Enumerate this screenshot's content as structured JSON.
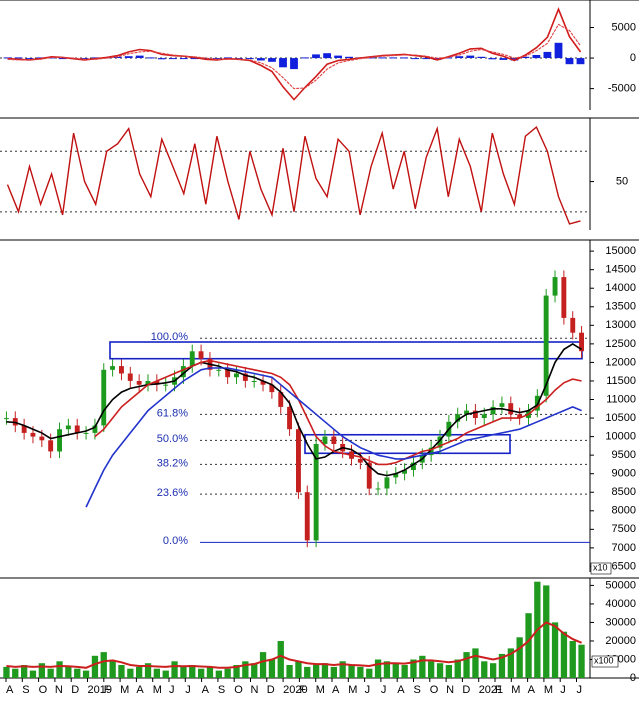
{
  "colors": {
    "price_up": "#1d9a1d",
    "price_down": "#c42020",
    "volume_bar": "#1f9a1f",
    "ma_short": "#000000",
    "ma_mid": "#cc1f1f",
    "ma_long": "#2233cc",
    "macd_hist": "#1020dd",
    "rsi_line": "#c01010",
    "fib_text": "#1d2fb0",
    "box_stroke": "#1622c6",
    "grid_dotted": "#333333",
    "axis_text": "#000000"
  },
  "chart_data": [
    {
      "type": "line",
      "panel": "macd",
      "y_ticks": [
        5000,
        0,
        -5000
      ],
      "y_tick_labels": [
        "5000",
        "0",
        "-5000"
      ],
      "ylim": [
        -8500,
        9500
      ],
      "series": [
        {
          "key": "macd",
          "color": "#d01c1c",
          "values": [
            -0.1,
            -0.2,
            -0.3,
            -0.1,
            0.2,
            0.1,
            -0.1,
            -0.3,
            -0.1,
            0.1,
            0.4,
            1.0,
            1.4,
            1.2,
            0.6,
            0.4,
            0.3,
            0.1,
            -0.2,
            -0.3,
            -0.1,
            -0.2,
            -0.4,
            -1.2,
            -2.2,
            -4.7,
            -6.8,
            -4.8,
            -3.0,
            -1.0,
            -0.4,
            -0.2,
            0.0,
            0.2,
            0.4,
            0.5,
            0.6,
            0.4,
            0.2,
            -0.3,
            0.2,
            0.8,
            1.5,
            1.6,
            0.8,
            0.3,
            -0.4,
            0.5,
            1.7,
            3.4,
            8.0,
            3.5,
            1.0
          ]
        },
        {
          "key": "signal",
          "color": "#e04040",
          "values": [
            -0.2,
            -0.3,
            -0.3,
            -0.2,
            0.1,
            0.1,
            0.0,
            -0.2,
            -0.2,
            0.0,
            0.2,
            0.7,
            1.0,
            1.1,
            0.8,
            0.5,
            0.3,
            0.2,
            0.0,
            -0.2,
            -0.2,
            -0.2,
            -0.3,
            -0.8,
            -1.6,
            -3.2,
            -5.0,
            -4.9,
            -3.6,
            -1.8,
            -0.8,
            -0.4,
            -0.1,
            0.1,
            0.3,
            0.4,
            0.5,
            0.5,
            0.3,
            0.0,
            0.1,
            0.5,
            1.1,
            1.4,
            1.0,
            0.6,
            0.0,
            0.3,
            1.2,
            2.4,
            5.5,
            4.5,
            2.0
          ]
        }
      ],
      "histogram": [
        0.1,
        0.1,
        0.0,
        0.1,
        0.1,
        0.0,
        -0.1,
        -0.1,
        0.1,
        0.1,
        0.2,
        0.3,
        0.4,
        0.1,
        -0.2,
        -0.1,
        0.0,
        -0.1,
        -0.2,
        -0.1,
        0.1,
        0.0,
        -0.1,
        -0.4,
        -0.6,
        -1.5,
        -1.8,
        0.1,
        0.6,
        0.8,
        0.4,
        0.2,
        0.1,
        0.1,
        0.1,
        0.1,
        0.1,
        -0.1,
        -0.1,
        -0.3,
        0.1,
        0.3,
        0.4,
        0.2,
        -0.2,
        -0.3,
        -0.4,
        0.2,
        0.5,
        1.0,
        2.5,
        -1.0,
        -1.0
      ]
    },
    {
      "type": "line",
      "panel": "rsi",
      "y_ticks": [
        50
      ],
      "y_tick_labels": [
        "50"
      ],
      "guides": [
        70,
        30
      ],
      "ylim": [
        18,
        92
      ],
      "series": [
        {
          "key": "rsi",
          "color": "#c01010",
          "values": [
            48,
            30,
            60,
            35,
            55,
            28,
            82,
            50,
            35,
            70,
            75,
            85,
            55,
            40,
            78,
            60,
            42,
            75,
            35,
            80,
            50,
            25,
            70,
            45,
            28,
            72,
            30,
            80,
            52,
            40,
            78,
            70,
            28,
            60,
            82,
            45,
            70,
            32,
            66,
            85,
            40,
            78,
            60,
            30,
            82,
            55,
            35,
            80,
            86,
            70,
            40,
            22,
            24
          ]
        }
      ]
    },
    {
      "type": "candlestick",
      "panel": "price",
      "x": [
        "A",
        "S",
        "O",
        "N",
        "D",
        "2019",
        "F",
        "M",
        "A",
        "M",
        "J",
        "J",
        "A",
        "S",
        "O",
        "N",
        "D",
        "2020",
        "F",
        "M",
        "A",
        "M",
        "J",
        "J",
        "A",
        "S",
        "O",
        "N",
        "D",
        "2021",
        "F",
        "M",
        "A",
        "M",
        "J",
        "J"
      ],
      "y_ticks": [
        6500,
        7000,
        7500,
        8000,
        8500,
        9000,
        9500,
        10000,
        10500,
        11000,
        11500,
        12000,
        12500,
        13000,
        13500,
        14000,
        14500,
        15000
      ],
      "y_tick_labels": [
        "6500",
        "7000",
        "7500",
        "8000",
        "8500",
        "9000",
        "9500",
        "10000",
        "10500",
        "11000",
        "11500",
        "12000",
        "12500",
        "13000",
        "13500",
        "14000",
        "14500",
        "15000"
      ],
      "ylim": [
        6350,
        15300
      ],
      "axis_unit_label": "x10",
      "close": [
        10500,
        10300,
        10100,
        10000,
        9900,
        9600,
        10200,
        10300,
        10100,
        10100,
        10300,
        11800,
        11900,
        11700,
        11500,
        11400,
        11500,
        11400,
        11400,
        11600,
        11900,
        12300,
        12100,
        11800,
        11800,
        11600,
        11700,
        11500,
        11500,
        11400,
        11200,
        10800,
        10200,
        8500,
        7200,
        9800,
        10000,
        9800,
        9600,
        9400,
        9300,
        8600,
        8600,
        8900,
        9000,
        9100,
        9300,
        9500,
        9700,
        10000,
        10400,
        10600,
        10700,
        10500,
        10600,
        10800,
        10900,
        10600,
        10500,
        10700,
        11100,
        13800,
        14300,
        13200,
        12800,
        12300
      ],
      "ma_series": [
        {
          "key": "ma_short",
          "color": "#000000",
          "values": [
            10400,
            10380,
            10300,
            10200,
            10100,
            9950,
            10000,
            10050,
            10100,
            10150,
            10250,
            10700,
            11000,
            11200,
            11300,
            11350,
            11400,
            11420,
            11450,
            11500,
            11700,
            11900,
            12000,
            11950,
            11900,
            11800,
            11750,
            11650,
            11600,
            11500,
            11400,
            11200,
            10900,
            10300,
            9800,
            9400,
            9450,
            9600,
            9700,
            9650,
            9500,
            9200,
            9000,
            8950,
            9000,
            9100,
            9250,
            9400,
            9650,
            9900,
            10200,
            10450,
            10600,
            10650,
            10700,
            10750,
            10750,
            10700,
            10650,
            10700,
            10850,
            11400,
            12000,
            12350,
            12500,
            12350
          ]
        },
        {
          "key": "ma_mid",
          "color": "#cc1f1f",
          "values": [
            null,
            null,
            null,
            null,
            null,
            null,
            null,
            null,
            null,
            null,
            10000,
            10200,
            10500,
            10800,
            11000,
            11200,
            11400,
            11500,
            11600,
            11700,
            11800,
            11900,
            12000,
            12050,
            12000,
            11950,
            11900,
            11850,
            11800,
            11750,
            11700,
            11600,
            11400,
            11000,
            10500,
            10000,
            9750,
            9600,
            9550,
            9500,
            9450,
            9350,
            9250,
            9250,
            9300,
            9400,
            9500,
            9600,
            9650,
            9750,
            9850,
            9950,
            10100,
            10200,
            10300,
            10400,
            10500,
            10500,
            10500,
            10600,
            10800,
            11000,
            11250,
            11450,
            11550,
            11500
          ]
        },
        {
          "key": "ma_long",
          "color": "#2233cc",
          "values": [
            null,
            null,
            null,
            null,
            null,
            null,
            null,
            null,
            null,
            8100,
            8600,
            9100,
            9500,
            9800,
            10100,
            10400,
            10700,
            10900,
            11100,
            11300,
            11500,
            11650,
            11800,
            11850,
            11850,
            11850,
            11800,
            11750,
            11700,
            11650,
            11600,
            11400,
            11200,
            11000,
            10800,
            10600,
            10400,
            10200,
            10000,
            9850,
            9700,
            9600,
            9500,
            9450,
            9400,
            9400,
            9450,
            9500,
            9550,
            9600,
            9700,
            9800,
            9900,
            9950,
            10000,
            10050,
            10100,
            10150,
            10200,
            10300,
            10400,
            10500,
            10600,
            10700,
            10800,
            10700
          ]
        }
      ],
      "fibonacci": [
        {
          "label": "100.0%",
          "value": 12650
        },
        {
          "label": "61.8%",
          "value": 10600
        },
        {
          "label": "50.0%",
          "value": 9900
        },
        {
          "label": "38.2%",
          "value": 9250
        },
        {
          "label": "23.6%",
          "value": 8450
        },
        {
          "label": "0.0%",
          "value": 7150
        }
      ],
      "boxes": [
        {
          "x_start_frac": 0.0,
          "x_end_frac": 1.0,
          "y_low": 12100,
          "y_high": 12550
        },
        {
          "x_start_frac": 0.0,
          "x_end_frac": 1.0,
          "y_low": 9550,
          "y_high": 10050
        }
      ]
    },
    {
      "type": "bar",
      "panel": "volume",
      "y_ticks": [
        50000,
        40000,
        30000,
        20000,
        10000,
        0
      ],
      "y_tick_labels": [
        "50000",
        "40000",
        "30000",
        "20000",
        "10000",
        "0"
      ],
      "ylim": [
        0,
        54000
      ],
      "axis_unit_label": "x100",
      "values": [
        6000,
        5000,
        7000,
        4000,
        8000,
        5000,
        9000,
        6000,
        5000,
        4000,
        12000,
        14000,
        9000,
        7000,
        5000,
        6000,
        8000,
        5000,
        4000,
        9000,
        6000,
        7000,
        5000,
        6000,
        4000,
        5000,
        7000,
        9000,
        8000,
        14000,
        10000,
        20000,
        7000,
        9000,
        6000,
        7000,
        8000,
        6000,
        9000,
        7000,
        6000,
        5000,
        10000,
        9000,
        8000,
        7000,
        10000,
        12000,
        9000,
        8000,
        7000,
        10000,
        14000,
        16000,
        9000,
        8000,
        13000,
        16000,
        22000,
        35000,
        52000,
        50000,
        30000,
        25000,
        20000,
        18000
      ],
      "ma_series": [
        {
          "key": "vol_ma",
          "color": "#cc1f1f",
          "values": [
            6500,
            6000,
            6300,
            6000,
            6200,
            6000,
            6500,
            6300,
            6000,
            5500,
            7500,
            9000,
            9500,
            8500,
            7000,
            6500,
            6500,
            6200,
            6000,
            6500,
            6300,
            6500,
            6200,
            6000,
            5500,
            5500,
            6000,
            7000,
            7500,
            9000,
            10000,
            12000,
            10000,
            9000,
            8000,
            7500,
            7500,
            7000,
            7500,
            7000,
            6800,
            6500,
            7500,
            8000,
            8000,
            7800,
            8500,
            9500,
            9500,
            9000,
            8500,
            9000,
            10500,
            12000,
            11000,
            10000,
            11000,
            13000,
            16000,
            20000,
            26000,
            30000,
            28000,
            24000,
            21000,
            19000
          ]
        }
      ],
      "x_labels": [
        "A",
        "S",
        "O",
        "N",
        "D",
        "2019",
        "F",
        "M",
        "A",
        "M",
        "J",
        "J",
        "A",
        "S",
        "O",
        "N",
        "D",
        "2020",
        "F",
        "M",
        "A",
        "M",
        "J",
        "J",
        "A",
        "S",
        "O",
        "N",
        "D",
        "2021",
        "F",
        "M",
        "A",
        "M",
        "J",
        "J"
      ]
    }
  ]
}
